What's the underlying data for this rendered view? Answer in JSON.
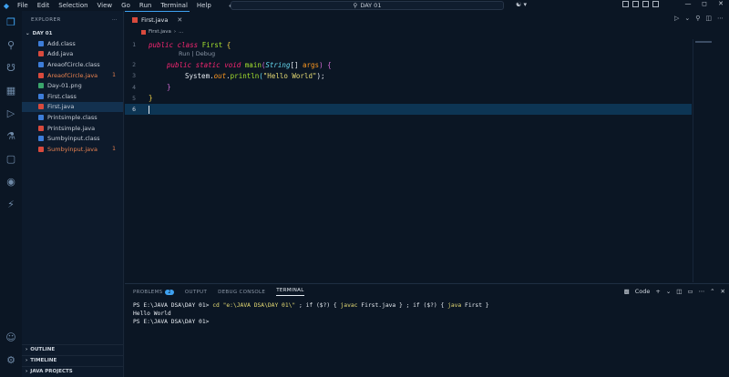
{
  "menu": [
    "File",
    "Edit",
    "Selection",
    "View",
    "Go",
    "Run",
    "Terminal",
    "Help"
  ],
  "search": {
    "text": "DAY 01"
  },
  "sidebar": {
    "header": "EXPLORER",
    "folder": "DAY 01",
    "files": [
      {
        "name": "Add.class",
        "color": "#3d7dd8",
        "badge": "",
        "err": false,
        "sel": false
      },
      {
        "name": "Add.java",
        "color": "#d84a3d",
        "badge": "",
        "err": false,
        "sel": false
      },
      {
        "name": "AreaofCircle.class",
        "color": "#3d7dd8",
        "badge": "",
        "err": false,
        "sel": false
      },
      {
        "name": "AreaofCircle.java",
        "color": "#d84a3d",
        "badge": "1",
        "err": true,
        "sel": false
      },
      {
        "name": "Day-01.png",
        "color": "#3aa56b",
        "badge": "",
        "err": false,
        "sel": false
      },
      {
        "name": "First.class",
        "color": "#3d7dd8",
        "badge": "",
        "err": false,
        "sel": false
      },
      {
        "name": "First.java",
        "color": "#d84a3d",
        "badge": "",
        "err": false,
        "sel": true
      },
      {
        "name": "Printsimple.class",
        "color": "#3d7dd8",
        "badge": "",
        "err": false,
        "sel": false
      },
      {
        "name": "Printsimple.java",
        "color": "#d84a3d",
        "badge": "",
        "err": false,
        "sel": false
      },
      {
        "name": "Sumbyinput.class",
        "color": "#3d7dd8",
        "badge": "",
        "err": false,
        "sel": false
      },
      {
        "name": "Sumbyinput.java",
        "color": "#d84a3d",
        "badge": "1",
        "err": true,
        "sel": false
      }
    ],
    "sections": [
      "OUTLINE",
      "TIMELINE",
      "JAVA PROJECTS"
    ]
  },
  "editor": {
    "tab": "First.java",
    "breadcrumb": "First.java",
    "breadcrumb_more": "...",
    "codelens": "Run | Debug",
    "lines": {
      "l1": [
        "public",
        "class",
        "First",
        "{"
      ],
      "l2": [
        "public",
        "static",
        "void",
        "main",
        "(",
        "String",
        "[]",
        "args",
        ")",
        "{"
      ],
      "l3": [
        "System",
        ".",
        "out",
        ".",
        "println",
        "(",
        "\"Hello World\"",
        ");"
      ],
      "l4": [
        "}"
      ],
      "l5": [
        "}"
      ]
    },
    "line_numbers": [
      "1",
      "2",
      "3",
      "4",
      "5",
      "6"
    ]
  },
  "panel": {
    "tabs": [
      "PROBLEMS",
      "OUTPUT",
      "DEBUG CONSOLE",
      "TERMINAL"
    ],
    "problems_count": "2",
    "shell_label": "Code",
    "terminal": {
      "prompt1": "PS E:\\JAVA DSA\\DAY 01> ",
      "cmd_cd": "cd",
      "cmd_path": "\"e:\\JAVA DSA\\DAY 01\\\"",
      "cmd_rest1": " ; if ($?) { ",
      "javac": "javac",
      "cmd_rest2": " First.java } ; if ($?) { ",
      "java": "java",
      "cmd_rest3": " First }",
      "output": "Hello World",
      "prompt2": "PS E:\\JAVA DSA\\DAY 01>"
    }
  }
}
